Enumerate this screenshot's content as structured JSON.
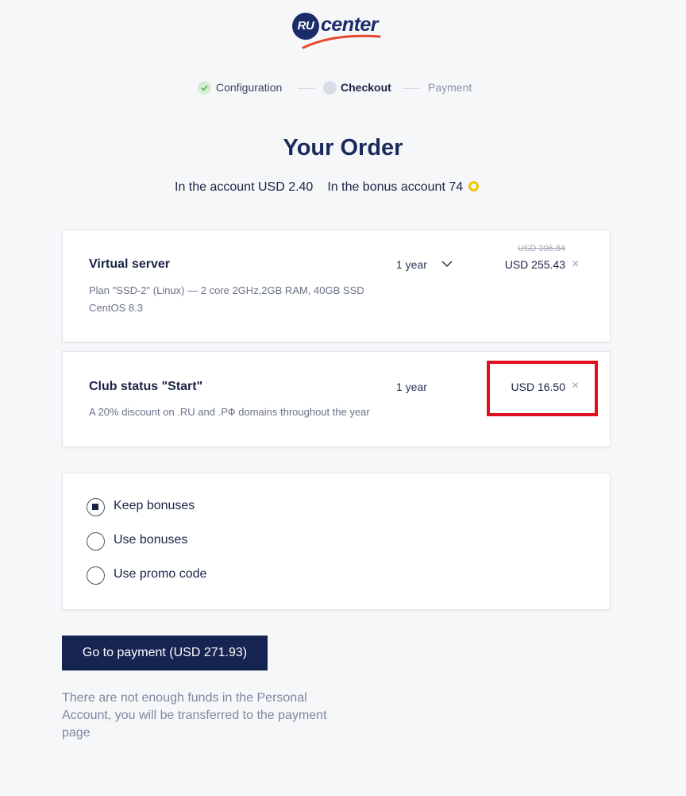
{
  "logo": {
    "badge": "RU",
    "word": "center"
  },
  "steps": [
    {
      "label": "Configuration",
      "state": "done"
    },
    {
      "label": "Checkout",
      "state": "active"
    },
    {
      "label": "Payment",
      "state": "pending"
    }
  ],
  "title": "Your Order",
  "balance": {
    "account": "In the account USD 2.40",
    "bonus": "In the bonus account 74"
  },
  "items": [
    {
      "name": "Virtual server",
      "description_line1": "Plan \"SSD-2\" (Linux) — 2 core 2GHz,2GB RAM, 40GB SSD",
      "description_line2": "CentOS 8.3",
      "period": "1 year",
      "old_price": "USD 306.84",
      "price": "USD 255.43",
      "remove": "×"
    },
    {
      "name": "Club status \"Start\"",
      "description_line1": "A 20% discount on .RU and .РФ domains throughout the year",
      "period": "1 year",
      "price": "USD 16.50",
      "remove": "×"
    }
  ],
  "bonus_options": [
    {
      "label": "Keep bonuses",
      "checked": true
    },
    {
      "label": "Use bonuses",
      "checked": false
    },
    {
      "label": "Use promo code",
      "checked": false
    }
  ],
  "pay_button": "Go to payment (USD 271.93)",
  "note": "There are not enough funds in the Personal Account, you will be transferred to the payment page",
  "colors": {
    "brand": "#1b2c6b",
    "swoosh": "#e8472c",
    "button": "#162452",
    "highlight": "#e0101e",
    "coin": "#f0c400"
  }
}
